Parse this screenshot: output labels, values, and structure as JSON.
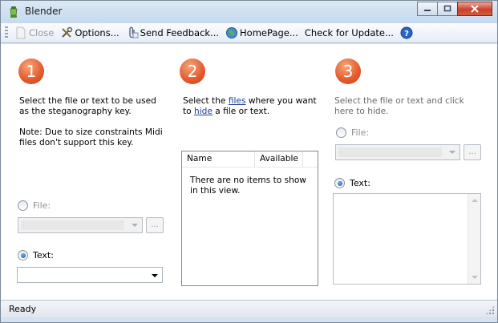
{
  "window": {
    "title": "Blender"
  },
  "toolbar": {
    "close_label": "Close",
    "options_label": "Options...",
    "feedback_label": "Send Feedback...",
    "homepage_label": "HomePage...",
    "update_label": "Check for Update..."
  },
  "steps": [
    {
      "number": "1",
      "description": "Select the file or text to be used as the steganography key.",
      "note": "Note: Due to size constraints Midi files don't support this key."
    },
    {
      "number": "2",
      "desc_prefix": "Select the ",
      "files_link": "files",
      "desc_middle": " where you want to ",
      "hide_link": "hide",
      "desc_suffix": " a file or text."
    },
    {
      "number": "3",
      "description": "Select the file or text and click here to hide."
    }
  ],
  "step1": {
    "file_label": "File:",
    "text_label": "Text:",
    "browse_label": "...",
    "selected": "text"
  },
  "step3": {
    "file_label": "File:",
    "text_label": "Text:",
    "browse_label": "...",
    "selected": "text"
  },
  "listview": {
    "columns": [
      "Name",
      "Available"
    ],
    "empty_text": "There are no items to show in this view."
  },
  "status": {
    "text": "Ready"
  },
  "colors": {
    "accent_orange": "#e3592c",
    "link_blue": "#1a3f9c",
    "titlebar": "#c6d9ee"
  }
}
